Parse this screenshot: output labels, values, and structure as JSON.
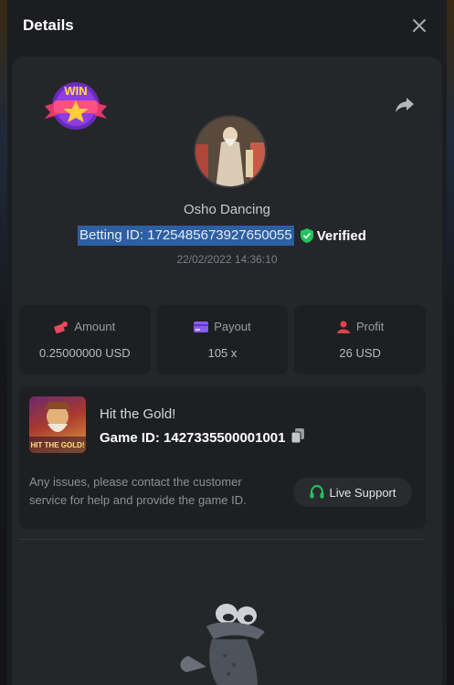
{
  "modal": {
    "title": "Details"
  },
  "bet": {
    "badge": "WIN",
    "player_name": "Osho Dancing",
    "betting_id": "Betting ID: 1725485673927650055",
    "verified_label": "Verified",
    "timestamp": "22/02/2022 14:36:10"
  },
  "stats": [
    {
      "label": "Amount",
      "value": "0.25000000 USD",
      "icon": "amount-icon",
      "color": "#e84a5f"
    },
    {
      "label": "Payout",
      "value": "105 x",
      "icon": "payout-card-icon",
      "color": "#8a5cf6"
    },
    {
      "label": "Profit",
      "value": "26 USD",
      "icon": "profit-icon",
      "color": "#e0424e"
    }
  ],
  "game": {
    "thumb_caption": "HIT THE GOLD!",
    "name": "Hit the Gold!",
    "game_id": "Game ID: 1427335500001001",
    "help_text": "Any issues, please contact the customer service for help and provide the game ID.",
    "support_label": "Live Support"
  },
  "colors": {
    "accent_green": "#22c55e",
    "selection_blue": "#2d5fa3",
    "card_bg": "#25262a"
  }
}
